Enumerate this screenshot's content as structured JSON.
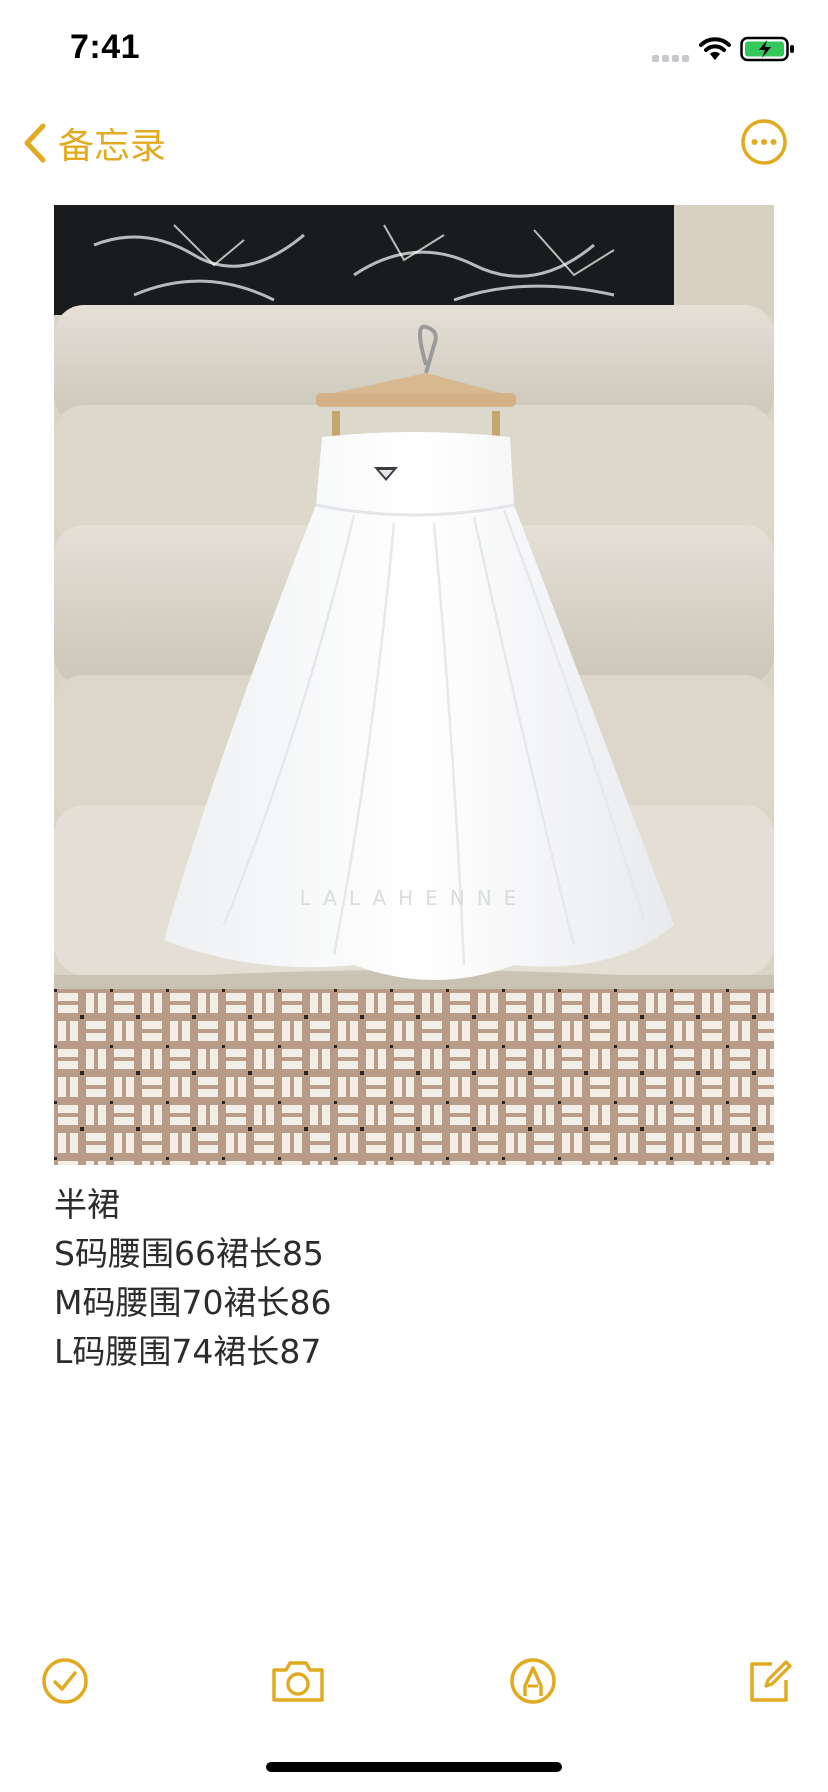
{
  "status_bar": {
    "time": "7:41",
    "icons": [
      "cellular-signal-icon",
      "wifi-icon",
      "battery-charging-icon"
    ]
  },
  "nav": {
    "back_label": "备忘录",
    "back_icon": "chevron-left-icon",
    "more_icon": "ellipsis-circle-icon",
    "accent_color": "#E2AA20"
  },
  "attachment": {
    "type": "photo",
    "watermark": "LALAHENNE"
  },
  "note": {
    "lines": [
      "半裙",
      "S码腰围66裙长85",
      "M码腰围70裙长86",
      "L码腰围74裙长87"
    ]
  },
  "toolbar": {
    "icons": [
      "checklist-icon",
      "camera-icon",
      "markup-pen-icon",
      "compose-icon"
    ]
  }
}
